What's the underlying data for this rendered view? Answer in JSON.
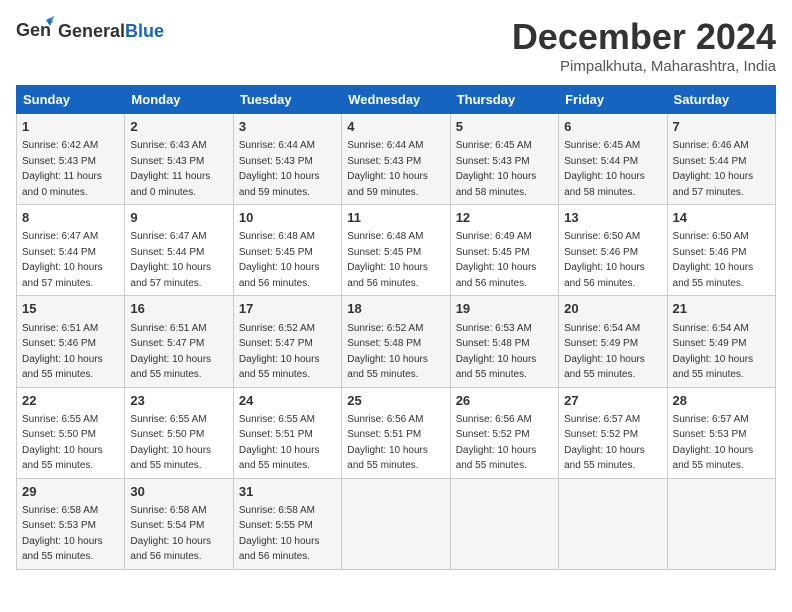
{
  "header": {
    "logo_line1": "General",
    "logo_line2": "Blue",
    "month": "December 2024",
    "location": "Pimpalkhuta, Maharashtra, India"
  },
  "weekdays": [
    "Sunday",
    "Monday",
    "Tuesday",
    "Wednesday",
    "Thursday",
    "Friday",
    "Saturday"
  ],
  "weeks": [
    [
      {
        "day": "1",
        "rise": "6:42 AM",
        "set": "5:43 PM",
        "daylight": "11 hours and 0 minutes"
      },
      {
        "day": "2",
        "rise": "6:43 AM",
        "set": "5:43 PM",
        "daylight": "11 hours and 0 minutes"
      },
      {
        "day": "3",
        "rise": "6:44 AM",
        "set": "5:43 PM",
        "daylight": "10 hours and 59 minutes"
      },
      {
        "day": "4",
        "rise": "6:44 AM",
        "set": "5:43 PM",
        "daylight": "10 hours and 59 minutes"
      },
      {
        "day": "5",
        "rise": "6:45 AM",
        "set": "5:43 PM",
        "daylight": "10 hours and 58 minutes"
      },
      {
        "day": "6",
        "rise": "6:45 AM",
        "set": "5:44 PM",
        "daylight": "10 hours and 58 minutes"
      },
      {
        "day": "7",
        "rise": "6:46 AM",
        "set": "5:44 PM",
        "daylight": "10 hours and 57 minutes"
      }
    ],
    [
      {
        "day": "8",
        "rise": "6:47 AM",
        "set": "5:44 PM",
        "daylight": "10 hours and 57 minutes"
      },
      {
        "day": "9",
        "rise": "6:47 AM",
        "set": "5:44 PM",
        "daylight": "10 hours and 57 minutes"
      },
      {
        "day": "10",
        "rise": "6:48 AM",
        "set": "5:45 PM",
        "daylight": "10 hours and 56 minutes"
      },
      {
        "day": "11",
        "rise": "6:48 AM",
        "set": "5:45 PM",
        "daylight": "10 hours and 56 minutes"
      },
      {
        "day": "12",
        "rise": "6:49 AM",
        "set": "5:45 PM",
        "daylight": "10 hours and 56 minutes"
      },
      {
        "day": "13",
        "rise": "6:50 AM",
        "set": "5:46 PM",
        "daylight": "10 hours and 56 minutes"
      },
      {
        "day": "14",
        "rise": "6:50 AM",
        "set": "5:46 PM",
        "daylight": "10 hours and 55 minutes"
      }
    ],
    [
      {
        "day": "15",
        "rise": "6:51 AM",
        "set": "5:46 PM",
        "daylight": "10 hours and 55 minutes"
      },
      {
        "day": "16",
        "rise": "6:51 AM",
        "set": "5:47 PM",
        "daylight": "10 hours and 55 minutes"
      },
      {
        "day": "17",
        "rise": "6:52 AM",
        "set": "5:47 PM",
        "daylight": "10 hours and 55 minutes"
      },
      {
        "day": "18",
        "rise": "6:52 AM",
        "set": "5:48 PM",
        "daylight": "10 hours and 55 minutes"
      },
      {
        "day": "19",
        "rise": "6:53 AM",
        "set": "5:48 PM",
        "daylight": "10 hours and 55 minutes"
      },
      {
        "day": "20",
        "rise": "6:54 AM",
        "set": "5:49 PM",
        "daylight": "10 hours and 55 minutes"
      },
      {
        "day": "21",
        "rise": "6:54 AM",
        "set": "5:49 PM",
        "daylight": "10 hours and 55 minutes"
      }
    ],
    [
      {
        "day": "22",
        "rise": "6:55 AM",
        "set": "5:50 PM",
        "daylight": "10 hours and 55 minutes"
      },
      {
        "day": "23",
        "rise": "6:55 AM",
        "set": "5:50 PM",
        "daylight": "10 hours and 55 minutes"
      },
      {
        "day": "24",
        "rise": "6:55 AM",
        "set": "5:51 PM",
        "daylight": "10 hours and 55 minutes"
      },
      {
        "day": "25",
        "rise": "6:56 AM",
        "set": "5:51 PM",
        "daylight": "10 hours and 55 minutes"
      },
      {
        "day": "26",
        "rise": "6:56 AM",
        "set": "5:52 PM",
        "daylight": "10 hours and 55 minutes"
      },
      {
        "day": "27",
        "rise": "6:57 AM",
        "set": "5:52 PM",
        "daylight": "10 hours and 55 minutes"
      },
      {
        "day": "28",
        "rise": "6:57 AM",
        "set": "5:53 PM",
        "daylight": "10 hours and 55 minutes"
      }
    ],
    [
      {
        "day": "29",
        "rise": "6:58 AM",
        "set": "5:53 PM",
        "daylight": "10 hours and 55 minutes"
      },
      {
        "day": "30",
        "rise": "6:58 AM",
        "set": "5:54 PM",
        "daylight": "10 hours and 56 minutes"
      },
      {
        "day": "31",
        "rise": "6:58 AM",
        "set": "5:55 PM",
        "daylight": "10 hours and 56 minutes"
      },
      null,
      null,
      null,
      null
    ]
  ],
  "labels": {
    "sunrise": "Sunrise:",
    "sunset": "Sunset:",
    "daylight": "Daylight:"
  }
}
